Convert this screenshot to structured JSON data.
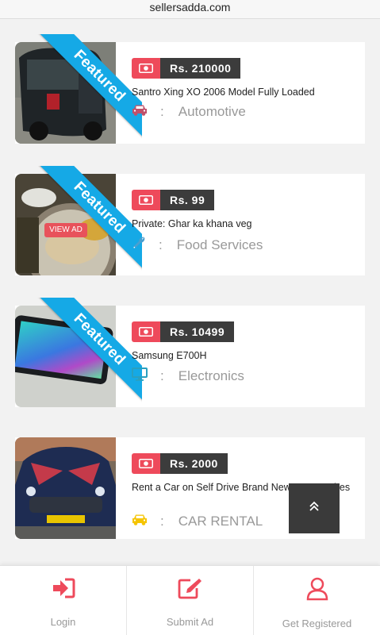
{
  "browser": {
    "url": "sellersadda.com"
  },
  "listings": [
    {
      "featured": "Featured",
      "price": "Rs. 210000",
      "title": "Santro Xing XO 2006 Model Fully Loaded",
      "colon": ":",
      "category": "Automotive",
      "category_icon": "car-icon",
      "icon_color": "#c0506a"
    },
    {
      "featured": "Featured",
      "price": "Rs. 99",
      "title": "Private: Ghar ka khana veg",
      "colon": ":",
      "category": "Food Services",
      "category_icon": "wrench-icon",
      "icon_color": "#4a9fd0",
      "view_ad": "VIEW AD"
    },
    {
      "featured": "Featured",
      "price": "Rs. 10499",
      "title": "Samsung E700H",
      "colon": ":",
      "category": "Electronics",
      "category_icon": "monitor-icon",
      "icon_color": "#2aa0c0"
    },
    {
      "price": "Rs. 2000",
      "title": "Rent a Car on Self Drive Brand New Your Desires",
      "colon": ":",
      "category": "CAR RENTAL",
      "category_icon": "car-icon",
      "icon_color": "#f5c400"
    }
  ],
  "bottom_nav": [
    {
      "label": "Login",
      "icon": "login-icon"
    },
    {
      "label": "Submit Ad",
      "icon": "edit-icon"
    },
    {
      "label": "Get Registered",
      "icon": "user-icon"
    }
  ],
  "colors": {
    "accent": "#ee4a5b",
    "ribbon": "#15a9e6",
    "price_bg": "#3c3c3c"
  }
}
